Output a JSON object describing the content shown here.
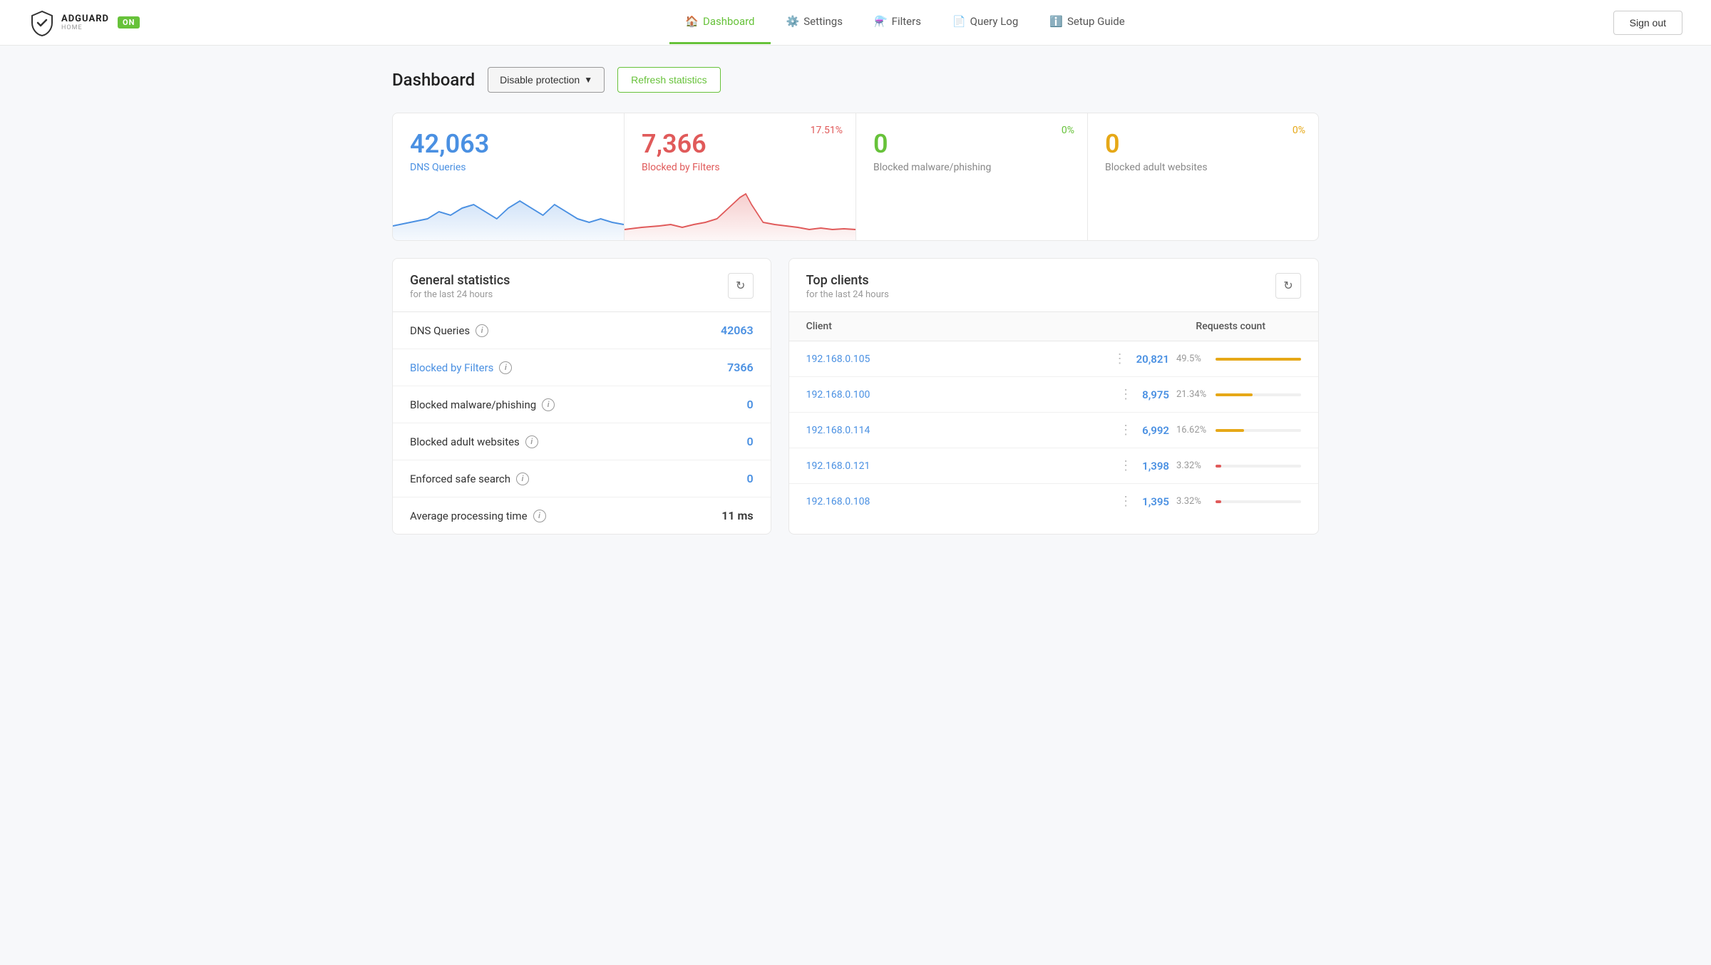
{
  "header": {
    "logo_title": "ADGUARD",
    "logo_sub": "HOME",
    "on_badge": "ON",
    "nav": [
      {
        "label": "Dashboard",
        "icon": "🏠",
        "active": true
      },
      {
        "label": "Settings",
        "icon": "⚙️",
        "active": false
      },
      {
        "label": "Filters",
        "icon": "⚗️",
        "active": false
      },
      {
        "label": "Query Log",
        "icon": "📄",
        "active": false
      },
      {
        "label": "Setup Guide",
        "icon": "ℹ️",
        "active": false
      }
    ],
    "sign_out": "Sign out"
  },
  "page": {
    "title": "Dashboard",
    "disable_btn": "Disable protection",
    "refresh_btn": "Refresh statistics"
  },
  "stat_cards": [
    {
      "number": "42,063",
      "label": "DNS Queries",
      "percent": "",
      "theme": "blue"
    },
    {
      "number": "7,366",
      "label": "Blocked by Filters",
      "percent": "17.51%",
      "theme": "red"
    },
    {
      "number": "0",
      "label": "Blocked malware/phishing",
      "percent": "0%",
      "theme": "green"
    },
    {
      "number": "0",
      "label": "Blocked adult websites",
      "percent": "0%",
      "theme": "yellow"
    }
  ],
  "general_stats": {
    "title": "General statistics",
    "subtitle": "for the last 24 hours",
    "rows": [
      {
        "label": "DNS Queries",
        "value": "42063",
        "link": false,
        "value_dark": false
      },
      {
        "label": "Blocked by Filters",
        "value": "7366",
        "link": true,
        "value_dark": false
      },
      {
        "label": "Blocked malware/phishing",
        "value": "0",
        "link": false,
        "value_dark": false
      },
      {
        "label": "Blocked adult websites",
        "value": "0",
        "link": false,
        "value_dark": false
      },
      {
        "label": "Enforced safe search",
        "value": "0",
        "link": false,
        "value_dark": false
      },
      {
        "label": "Average processing time",
        "value": "11 ms",
        "link": false,
        "value_dark": true
      }
    ]
  },
  "top_clients": {
    "title": "Top clients",
    "subtitle": "for the last 24 hours",
    "col_client": "Client",
    "col_requests": "Requests count",
    "clients": [
      {
        "ip": "192.168.0.105",
        "count": "20,821",
        "percent": "49.5%",
        "bar": 100,
        "color": "#e6a817"
      },
      {
        "ip": "192.168.0.100",
        "count": "8,975",
        "percent": "21.34%",
        "bar": 43,
        "color": "#e6a817"
      },
      {
        "ip": "192.168.0.114",
        "count": "6,992",
        "percent": "16.62%",
        "bar": 33,
        "color": "#e6a817"
      },
      {
        "ip": "192.168.0.121",
        "count": "1,398",
        "percent": "3.32%",
        "bar": 7,
        "color": "#e05a5a"
      },
      {
        "ip": "192.168.0.108",
        "count": "1,395",
        "percent": "3.32%",
        "bar": 7,
        "color": "#e05a5a"
      }
    ]
  }
}
